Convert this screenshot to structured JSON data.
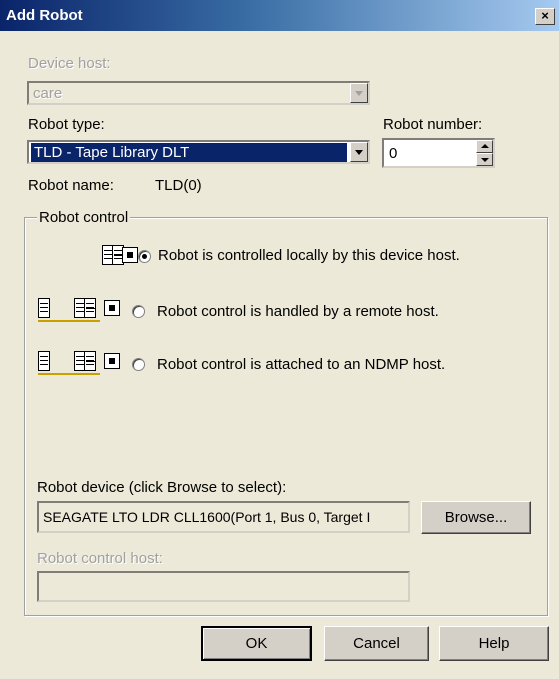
{
  "window": {
    "title": "Add Robot",
    "close_glyph": "×"
  },
  "device_host": {
    "label": "Device host:",
    "value": "care"
  },
  "robot_type": {
    "label": "Robot type:",
    "value": "TLD - Tape Library DLT"
  },
  "robot_number": {
    "label": "Robot number:",
    "value": "0"
  },
  "robot_name": {
    "label": "Robot name:",
    "value": "TLD(0)"
  },
  "robot_control": {
    "label": "Robot control",
    "options": [
      {
        "label": "Robot is controlled locally by this device host.",
        "selected": true,
        "icon": "local-robot-icon"
      },
      {
        "label": "Robot control is handled by a remote host.",
        "selected": false,
        "icon": "remote-robot-icon"
      },
      {
        "label": "Robot control is attached to an NDMP host.",
        "selected": false,
        "icon": "ndmp-robot-icon"
      }
    ]
  },
  "robot_device": {
    "label": "Robot device  (click Browse to select):",
    "value": "SEAGATE LTO LDR CLL1600(Port 1, Bus 0, Target I",
    "browse_label": "Browse..."
  },
  "robot_control_host": {
    "label": "Robot control host:",
    "value": ""
  },
  "footer": {
    "ok_label": "OK",
    "cancel_label": "Cancel",
    "help_label": "Help"
  }
}
